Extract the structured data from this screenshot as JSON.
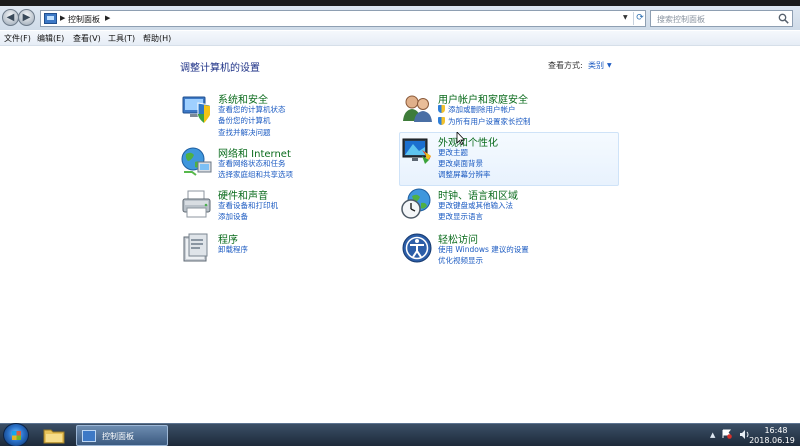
{
  "address": {
    "path": "控制面板",
    "search_placeholder": "搜索控制面板"
  },
  "menu": [
    "文件(F)",
    "编辑(E)",
    "查看(V)",
    "工具(T)",
    "帮助(H)"
  ],
  "heading": "调整计算机的设置",
  "view_by": {
    "label": "查看方式:",
    "value": "类别"
  },
  "categories": [
    {
      "icon": "shield-pc-icon",
      "title": "系统和安全",
      "links": [
        "查看您的计算机状态",
        "备份您的计算机",
        "查找并解决问题"
      ]
    },
    {
      "icon": "network-globe-icon",
      "title": "网络和 Internet",
      "links": [
        "查看网络状态和任务",
        "选择家庭组和共享选项"
      ]
    },
    {
      "icon": "printer-icon",
      "title": "硬件和声音",
      "links": [
        "查看设备和打印机",
        "添加设备"
      ]
    },
    {
      "icon": "programs-icon",
      "title": "程序",
      "links": [
        "卸载程序"
      ]
    },
    {
      "icon": "users-icon",
      "title": "用户帐户和家庭安全",
      "links": [
        "添加或删除用户帐户",
        "为所有用户设置家长控制"
      ]
    },
    {
      "icon": "display-palette-icon",
      "title": "外观和个性化",
      "links": [
        "更改主题",
        "更改桌面背景",
        "调整屏幕分辨率"
      ]
    },
    {
      "icon": "clock-globe-icon",
      "title": "时钟、语言和区域",
      "links": [
        "更改键盘或其他输入法",
        "更改显示语言"
      ]
    },
    {
      "icon": "ease-of-access-icon",
      "title": "轻松访问",
      "links": [
        "使用 Windows 建议的设置",
        "优化视频显示"
      ]
    }
  ],
  "taskbar": {
    "task_label": "控制面板",
    "time": "16:48",
    "date": "2018.06.19"
  }
}
